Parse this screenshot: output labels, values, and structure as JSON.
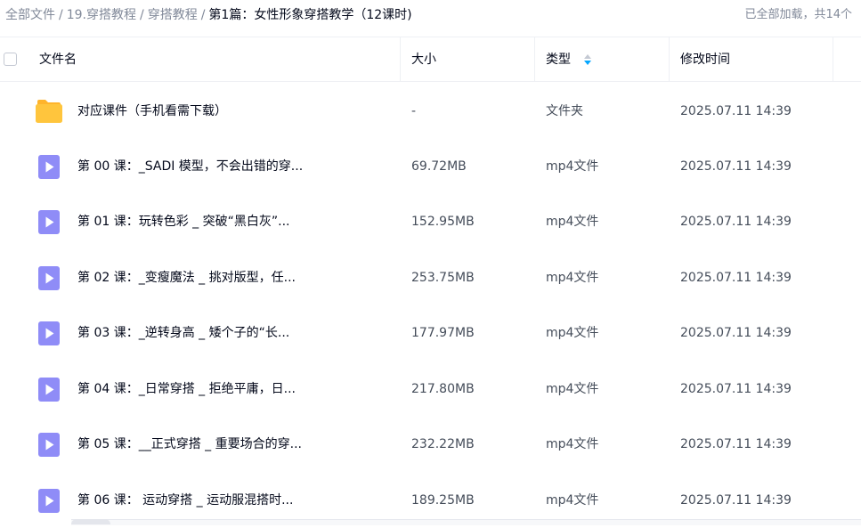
{
  "breadcrumb": {
    "items": [
      "全部文件",
      "19.穿搭教程",
      "穿搭教程",
      "第1篇：女性形象穿搭教学（12课时)"
    ],
    "separator": "/"
  },
  "status": {
    "loaded_text": "已全部加载，共14个"
  },
  "table": {
    "columns": {
      "name": "文件名",
      "size": "大小",
      "type": "类型",
      "modified": "修改时间"
    },
    "sort_icon": "sort-arrows-icon",
    "rows": [
      {
        "icon": "folder-icon",
        "name": "对应课件（手机看需下载）",
        "size": "-",
        "type": "文件夹",
        "modified": "2025.07.11 14:39"
      },
      {
        "icon": "video-file-icon",
        "name": "第 00 课：_SADI 模型，不会出错的穿...",
        "size": "69.72MB",
        "type": "mp4文件",
        "modified": "2025.07.11 14:39"
      },
      {
        "icon": "video-file-icon",
        "name": "第 01 课：玩转色彩 _ 突破“黑白灰”...",
        "size": "152.95MB",
        "type": "mp4文件",
        "modified": "2025.07.11 14:39"
      },
      {
        "icon": "video-file-icon",
        "name": "第 02 课：_变瘦魔法 _ 挑对版型，任...",
        "size": "253.75MB",
        "type": "mp4文件",
        "modified": "2025.07.11 14:39"
      },
      {
        "icon": "video-file-icon",
        "name": "第 03 课：_逆转身高 _ 矮个子的“长...",
        "size": "177.97MB",
        "type": "mp4文件",
        "modified": "2025.07.11 14:39"
      },
      {
        "icon": "video-file-icon",
        "name": "第 04 课：_日常穿搭 _ 拒绝平庸，日...",
        "size": "217.80MB",
        "type": "mp4文件",
        "modified": "2025.07.11 14:39"
      },
      {
        "icon": "video-file-icon",
        "name": "第 05 课：__正式穿搭 _ 重要场合的穿...",
        "size": "232.22MB",
        "type": "mp4文件",
        "modified": "2025.07.11 14:39"
      },
      {
        "icon": "video-file-icon",
        "name": "第 06 课： 运动穿搭 _ 运动服混搭时...",
        "size": "189.25MB",
        "type": "mp4文件",
        "modified": "2025.07.11 14:39"
      }
    ]
  },
  "colors": {
    "folder": "#ffc53d",
    "video_icon": "#8f8cf7",
    "sort_active": "#06a7ff",
    "sort_inactive": "#c4c9d3",
    "text_primary": "#03081a",
    "text_secondary": "#818999"
  }
}
